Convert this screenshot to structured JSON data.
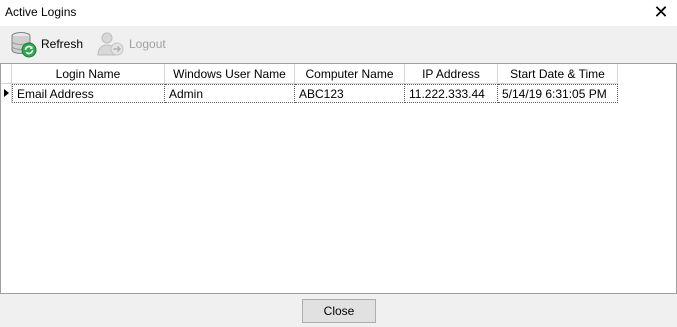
{
  "window": {
    "title": "Active Logins",
    "close_glyph": "✕"
  },
  "toolbar": {
    "refresh_label": "Refresh",
    "refresh_icon": "database-refresh-icon",
    "logout_label": "Logout",
    "logout_icon": "user-logout-icon",
    "logout_enabled": false
  },
  "grid": {
    "columns": [
      "Login Name",
      "Windows User Name",
      "Computer Name",
      "IP Address",
      "Start Date & Time"
    ],
    "rows": [
      {
        "login_name": "Email Address",
        "windows_user": "Admin",
        "computer_name": "ABC123",
        "ip_address": "11.222.333.44",
        "start": "5/14/19 6:31:05 PM"
      }
    ]
  },
  "footer": {
    "close_label": "Close"
  }
}
